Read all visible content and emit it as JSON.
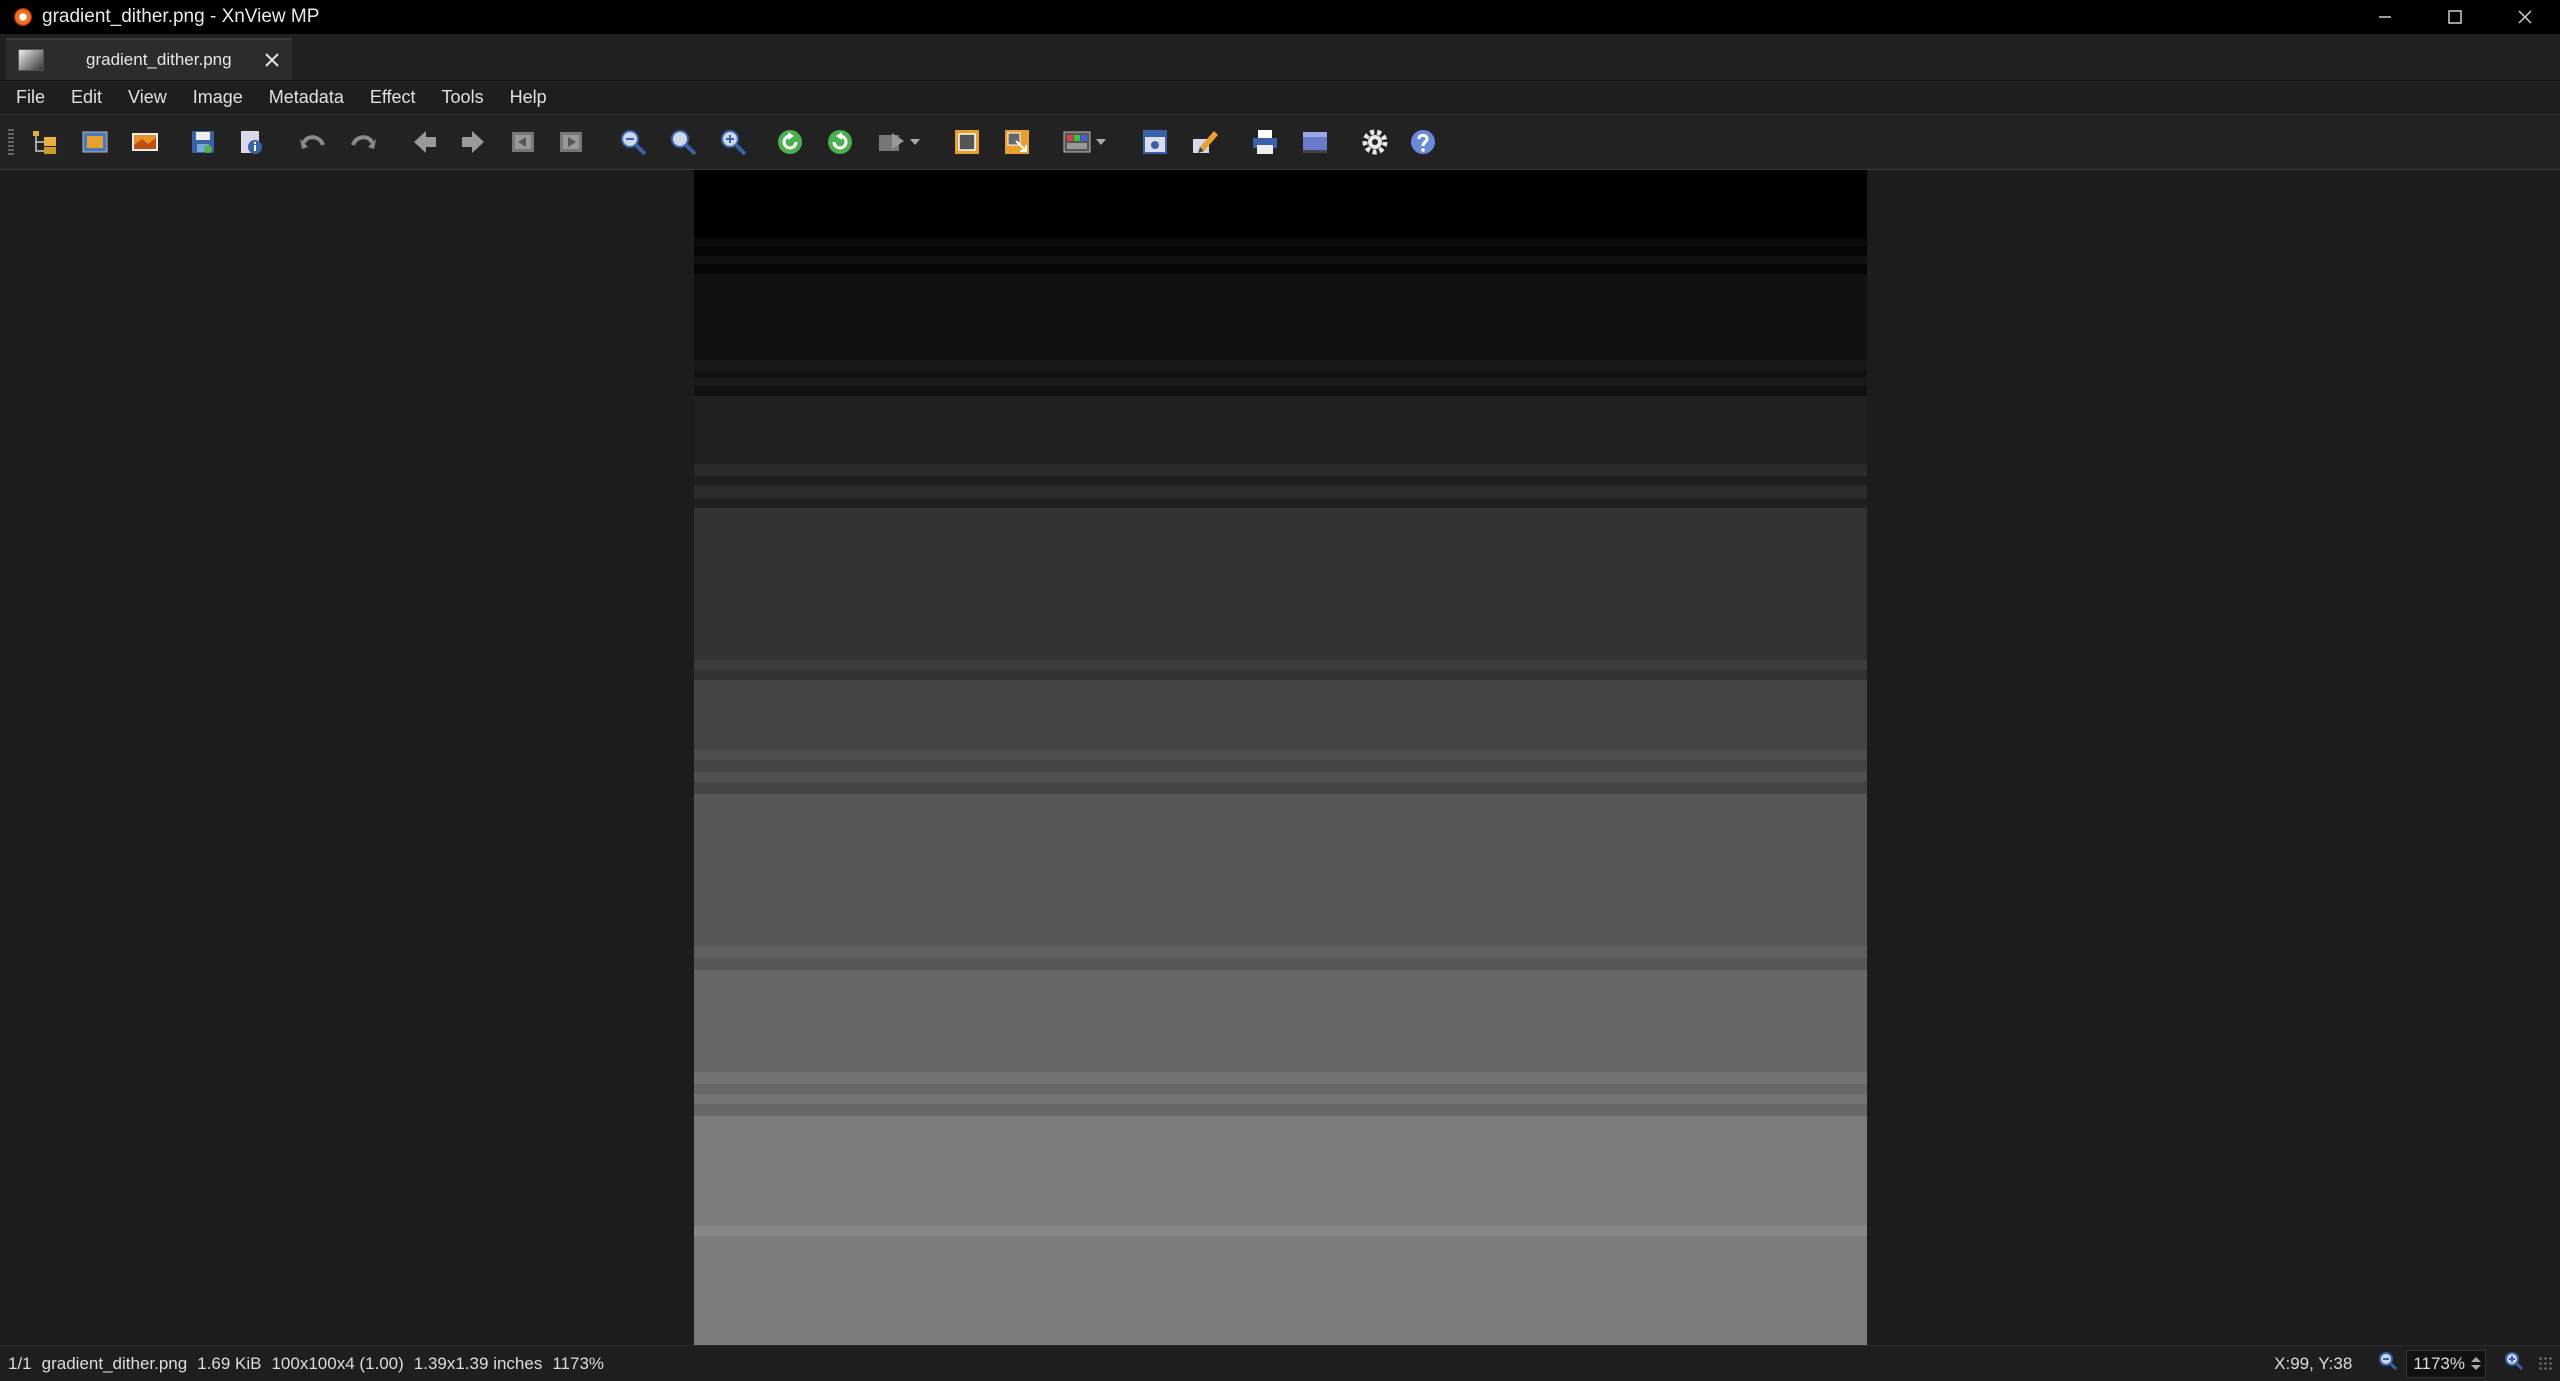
{
  "window": {
    "title": "gradient_dither.png - XnView MP"
  },
  "tab": {
    "label": "gradient_dither.png"
  },
  "menu": [
    "File",
    "Edit",
    "View",
    "Image",
    "Metadata",
    "Effect",
    "Tools",
    "Help"
  ],
  "toolbar": {
    "icons": [
      "browser-icon",
      "fullscreen-icon",
      "open-icon",
      "save-icon",
      "properties-icon",
      "undo-icon",
      "redo-icon",
      "previous-icon",
      "next-icon",
      "first-page-icon",
      "last-page-icon",
      "zoom-out-icon",
      "zoom-fit-icon",
      "zoom-in-icon",
      "rotate-left-icon",
      "rotate-right-icon",
      "export-icon",
      "crop-icon",
      "resize-icon",
      "color-adjust-icon",
      "capture-icon",
      "edit-icon",
      "print-icon",
      "display-icon",
      "settings-icon",
      "help-icon"
    ]
  },
  "image": {
    "name": "gradient_dither.png",
    "description_colors": [
      "#000000",
      "#7c7c7c"
    ]
  },
  "status": {
    "page": "1/1",
    "filename": "gradient_dither.png",
    "filesize": "1.69 KiB",
    "dimensions": "100x100x4 (1.00)",
    "print_size": "1.39x1.39 inches",
    "zoom": "1173%",
    "coords": "X:99, Y:38",
    "zoom_value": "1173%"
  }
}
